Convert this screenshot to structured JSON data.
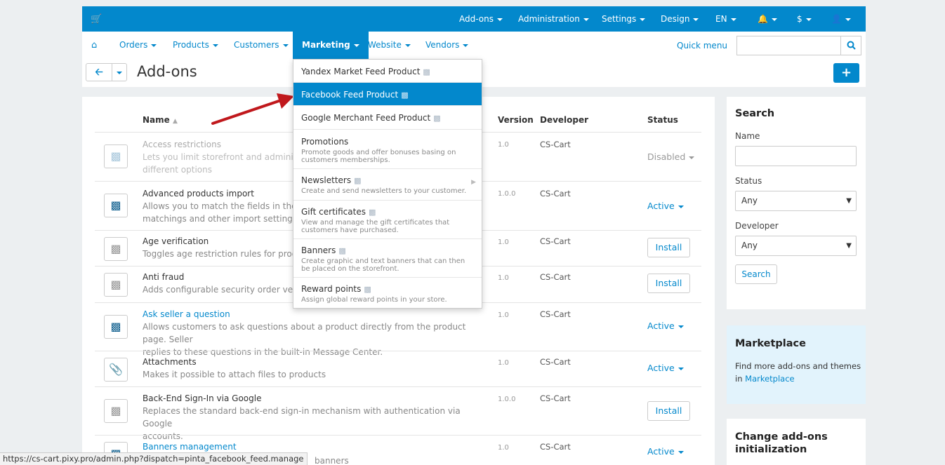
{
  "topbar": {
    "cart_icon": "cart-icon",
    "items": [
      "Add-ons",
      "Administration",
      "Settings",
      "Design",
      "EN",
      "$"
    ],
    "bell_icon": "bell-icon",
    "user_icon": "user-icon"
  },
  "nav": {
    "home_icon": "home-icon",
    "items": [
      "Orders",
      "Products",
      "Customers",
      "Marketing",
      "Website",
      "Vendors"
    ],
    "active": "Marketing",
    "quick_menu": "Quick menu",
    "search_placeholder": ""
  },
  "page": {
    "title": "Add-ons",
    "back_icon": "arrow-left-icon",
    "add_icon": "plus-icon"
  },
  "table": {
    "headers": {
      "name": "Name",
      "version": "Version",
      "developer": "Developer",
      "status": "Status"
    },
    "rows": [
      {
        "name": "Access restrictions",
        "desc": "Lets you limit storefront and administra… different options",
        "desc1": "Lets you limit storefront and administra",
        "desc2": "different options",
        "version": "1.0",
        "developer": "CS-Cart",
        "status": "Disabled",
        "icon": "puzzle-icon"
      },
      {
        "name": "Advanced products import",
        "desc1": "Allows you to match the fields in the im",
        "desc2": "matchings and other import settings ca",
        "version": "1.0.0",
        "developer": "CS-Cart",
        "status": "Active",
        "icon": "puzzle-icon"
      },
      {
        "name": "Age verification",
        "desc1": "Toggles age restriction rules for product",
        "version": "1.0",
        "developer": "CS-Cart",
        "status": "Install",
        "icon": "puzzle-icon"
      },
      {
        "name": "Anti fraud",
        "desc1": "Adds configurable security order verifica",
        "version": "1.0",
        "developer": "CS-Cart",
        "status": "Install",
        "icon": "puzzle-icon"
      },
      {
        "name": "Ask seller a question",
        "desc1": "Allows customers to ask questions about a product directly from the product page. Seller",
        "desc2": "replies to these questions in the built-in Message Center.",
        "version": "1.0",
        "developer": "CS-Cart",
        "status": "Active",
        "icon": "puzzle-icon"
      },
      {
        "name": "Attachments",
        "desc1": "Makes it possible to attach files to products",
        "version": "1.0",
        "developer": "CS-Cart",
        "status": "Active",
        "icon": "paperclip-icon"
      },
      {
        "name": "Back-End Sign-In via Google",
        "desc1": "Replaces the standard back-end sign-in mechanism with authentication via Google",
        "desc2": "accounts.",
        "version": "1.0.0",
        "developer": "CS-Cart",
        "status": "Install",
        "icon": "puzzle-icon"
      },
      {
        "name": "Banners management",
        "desc1": "banners",
        "version": "1.0",
        "developer": "CS-Cart",
        "status": "Active",
        "icon": "puzzle-icon"
      }
    ]
  },
  "dropdown": [
    {
      "title": "Yandex Market Feed Product",
      "desc": ""
    },
    {
      "title": "Facebook Feed Product",
      "desc": ""
    },
    {
      "title": "Google Merchant Feed Product",
      "desc": ""
    },
    {
      "title": "Promotions",
      "desc": "Promote goods and offer bonuses basing on customers memberships."
    },
    {
      "title": "Newsletters",
      "desc": "Create and send newsletters to your customer."
    },
    {
      "title": "Gift certificates",
      "desc": "View and manage the gift certificates that customers have purchased."
    },
    {
      "title": "Banners",
      "desc": "Create graphic and text banners that can then be placed on the storefront."
    },
    {
      "title": "Reward points",
      "desc": "Assign global reward points in your store."
    }
  ],
  "sidebar": {
    "search": {
      "title": "Search",
      "name_label": "Name",
      "status_label": "Status",
      "status_value": "Any",
      "developer_label": "Developer",
      "developer_value": "Any",
      "button": "Search"
    },
    "marketplace": {
      "title": "Marketplace",
      "text": "Find more add-ons and themes in",
      "link": "Marketplace"
    },
    "init": {
      "title1": "Change add-ons",
      "title2": "initialization"
    }
  },
  "statusbar": "https://cs-cart.pixy.pro/admin.php?dispatch=pinta_facebook_feed.manage",
  "colors": {
    "accent": "#0388cc",
    "arrow": "#c0181c"
  }
}
